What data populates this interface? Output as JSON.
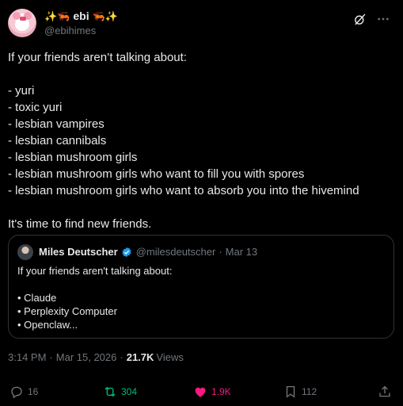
{
  "author": {
    "display_name": "ebi",
    "handle": "@ebihimes",
    "name_emoji_left": [
      "✨",
      "🦐"
    ],
    "name_emoji_right": [
      "🦐",
      "✨"
    ]
  },
  "header_icons": [
    "grok-icon",
    "more-icon"
  ],
  "tweet": {
    "intro": "If your friends aren’t talking about:",
    "items": [
      "- yuri",
      "- toxic yuri",
      "- lesbian vampires",
      "- lesbian cannibals",
      "- lesbian mushroom girls",
      "- lesbian mushroom girls who want to fill you with spores",
      "- lesbian mushroom girls who want to absorb you into the hivemind"
    ],
    "outro": "It's time to find new friends."
  },
  "quote": {
    "name": "Miles Deutscher",
    "handle": "@milesdeutscher",
    "separator": "·",
    "date": "Mar 13",
    "intro": "If your friends aren't talking about:",
    "items": [
      "• Claude",
      "• Perplexity Computer",
      "• Openclaw..."
    ]
  },
  "meta": {
    "time": "3:14 PM",
    "separator": "·",
    "date": "Mar 15, 2026",
    "views_count": "21.7K",
    "views_label": "Views"
  },
  "actions": {
    "replies": "16",
    "reposts": "304",
    "likes": "1.9K",
    "bookmarks": "112"
  },
  "colors": {
    "background": "#000000",
    "text": "#e7e9ea",
    "muted": "#71767b",
    "border": "#2f3336",
    "repost": "#00ba7c",
    "like": "#f91880",
    "verified": "#1d9bf0"
  }
}
